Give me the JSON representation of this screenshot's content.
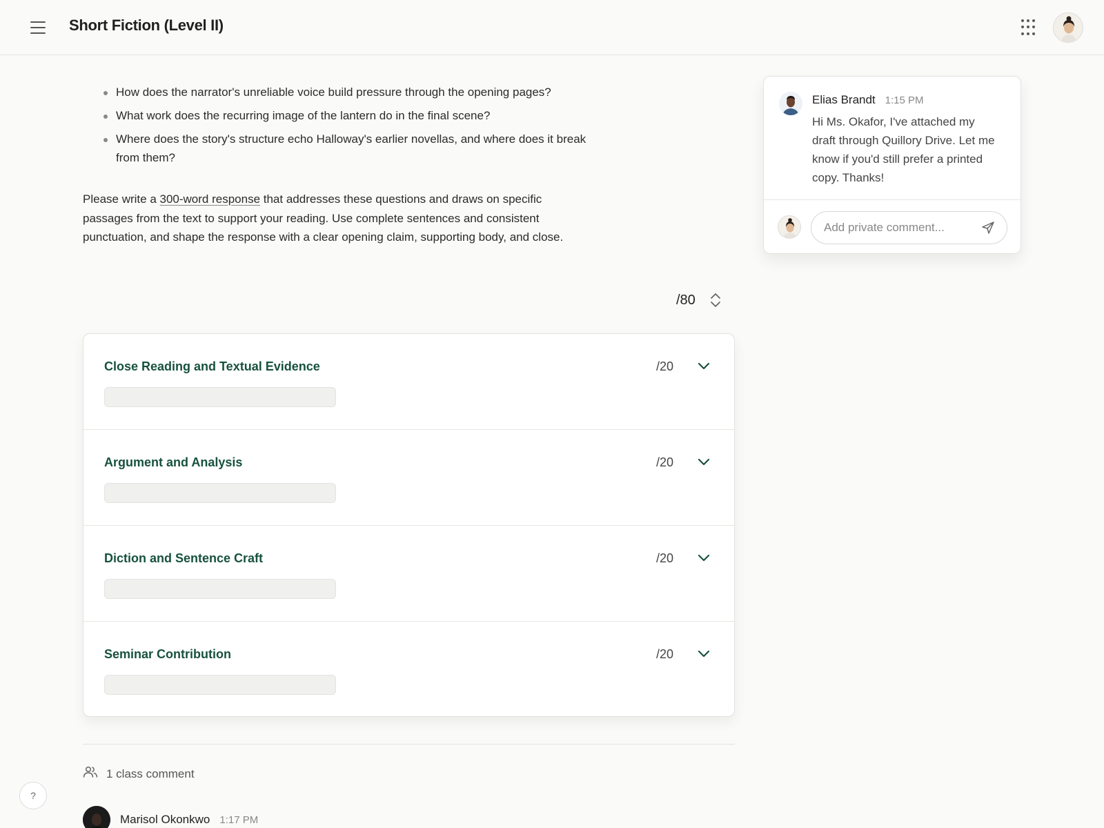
{
  "header": {
    "title": "Short Fiction (Level II)"
  },
  "questions": [
    "How does the narrator's unreliable voice build pressure through the opening pages?",
    "What work does the recurring image of the lantern do in the final scene?",
    "Where does the story's structure echo Halloway's earlier novellas, and where does it break from them?"
  ],
  "prompt": {
    "before": "Please write a ",
    "link": "300-word response",
    "after": " that addresses these questions and draws on specific passages from the text to support your reading. Use complete sentences and consistent punctuation, and shape the response with a clear opening claim, supporting body, and close."
  },
  "total": {
    "label": "/80"
  },
  "rubric": [
    {
      "title": "Close Reading and Textual Evidence",
      "score": "/20"
    },
    {
      "title": "Argument and Analysis",
      "score": "/20"
    },
    {
      "title": "Diction and Sentence Craft",
      "score": "/20"
    },
    {
      "title": "Seminar Contribution",
      "score": "/20"
    }
  ],
  "class_comments": {
    "label": "1 class comment",
    "items": [
      {
        "name": "Marisol Okonkwo",
        "time": "1:17 PM"
      }
    ]
  },
  "private_comment": {
    "name": "Elias Brandt",
    "time": "1:15 PM",
    "text": "Hi Ms. Okafor, I've attached my draft through Quillory Drive. Let me know if you'd still prefer a printed copy. Thanks!",
    "input_placeholder": "Add private comment..."
  },
  "help": {
    "label": "?"
  },
  "colors": {
    "accent": "#17513f",
    "background": "#fafaf8"
  }
}
